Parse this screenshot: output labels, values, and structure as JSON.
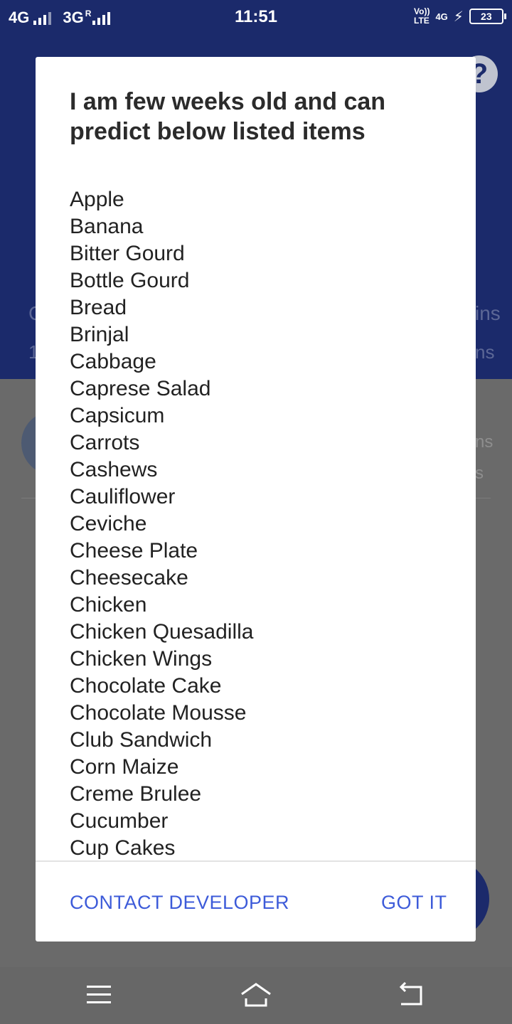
{
  "status_bar": {
    "net1": "4G",
    "net2": "3G",
    "roaming": "R",
    "time": "11:51",
    "volte_top": "Vo))",
    "volte_bottom": "LTE",
    "net_right": "4G",
    "battery": "23"
  },
  "dialog": {
    "title": "I am few weeks old and can predict below listed items",
    "items": [
      "Apple",
      "Banana",
      "Bitter Gourd",
      "Bottle Gourd",
      "Bread",
      "Brinjal",
      "Cabbage",
      "Caprese Salad",
      "Capsicum",
      "Carrots",
      "Cashews",
      "Cauliflower",
      "Ceviche",
      "Cheese Plate",
      "Cheesecake",
      "Chicken",
      "Chicken Quesadilla",
      "Chicken Wings",
      "Chocolate Cake",
      "Chocolate Mousse",
      "Club Sandwich",
      "Corn Maize",
      "Creme Brulee",
      "Cucumber",
      "Cup Cakes"
    ],
    "contact_label": "CONTACT DEVELOPER",
    "gotit_label": "GOT IT"
  },
  "background": {
    "help_symbol": "?",
    "stat_left": "C",
    "stat_left_sub": "1",
    "stat_right": "ins",
    "stat_right_sub": "ns",
    "row_right": "ns",
    "row_right_sub": "s"
  },
  "icons": {
    "help": "help-icon",
    "menu": "menu-icon",
    "home": "home-icon",
    "back": "back-icon"
  },
  "colors": {
    "header_bg": "#1b2a6b",
    "scrim": "#676767",
    "accent": "#3d5bd9",
    "dialog_bg": "#ffffff"
  }
}
